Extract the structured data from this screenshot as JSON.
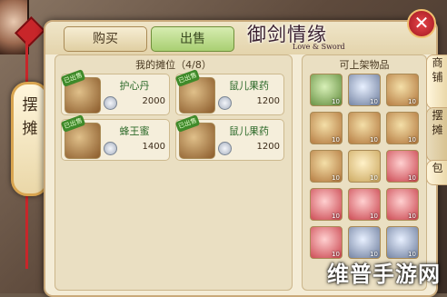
{
  "window": {
    "close_label": "✕"
  },
  "logo": {
    "title": "御剑情缘",
    "subtitle": "Love & Sword"
  },
  "side_tab": {
    "line1": "摆",
    "line2": "摊"
  },
  "tabs": {
    "buy": "购买",
    "sell": "出售"
  },
  "right_tabs": {
    "shop": [
      "商",
      "铺"
    ],
    "stall": [
      "摆",
      "摊"
    ],
    "bag": [
      "包"
    ]
  },
  "my_stall": {
    "title": "我的摊位（4/8）",
    "slots": [
      {
        "tag": "已出售",
        "name": "护心丹",
        "price": "2000",
        "icon": "pill-box-icon"
      },
      {
        "tag": "已出售",
        "name": "鼠儿果药",
        "price": "1200",
        "icon": "fruit-cluster-icon"
      },
      {
        "tag": "已出售",
        "name": "蜂王蜜",
        "price": "1400",
        "icon": "honey-jar-icon"
      },
      {
        "tag": "已出售",
        "name": "鼠儿果药",
        "price": "1200",
        "icon": "fruit-cluster-icon"
      }
    ]
  },
  "available": {
    "title": "可上架物品",
    "items": [
      {
        "kind": "green",
        "qty": "10",
        "icon": "jade-scroll-icon"
      },
      {
        "kind": "blue",
        "qty": "10",
        "icon": "pill-box-icon"
      },
      {
        "kind": "",
        "qty": "10",
        "icon": "fruit-cluster-icon"
      },
      {
        "kind": "",
        "qty": "10",
        "icon": "fruit-cluster-icon"
      },
      {
        "kind": "",
        "qty": "10",
        "icon": "honey-jar-icon"
      },
      {
        "kind": "",
        "qty": "10",
        "icon": "fruit-cluster-icon"
      },
      {
        "kind": "",
        "qty": "10",
        "icon": "honey-jar-icon"
      },
      {
        "kind": "scroll",
        "qty": "10",
        "icon": "paper-scroll-icon"
      },
      {
        "kind": "red",
        "qty": "10",
        "icon": "red-pouch-icon"
      },
      {
        "kind": "red",
        "qty": "10",
        "icon": "red-pouch-icon"
      },
      {
        "kind": "red",
        "qty": "10",
        "icon": "red-pouch-icon"
      },
      {
        "kind": "red",
        "qty": "10",
        "icon": "red-pouch-icon"
      },
      {
        "kind": "red",
        "qty": "10",
        "icon": "red-pouch-icon"
      },
      {
        "kind": "blue",
        "qty": "10",
        "icon": "potion-jar-icon"
      },
      {
        "kind": "blue",
        "qty": "10",
        "icon": "potion-jar-icon"
      }
    ]
  },
  "watermark": "维普手游网"
}
